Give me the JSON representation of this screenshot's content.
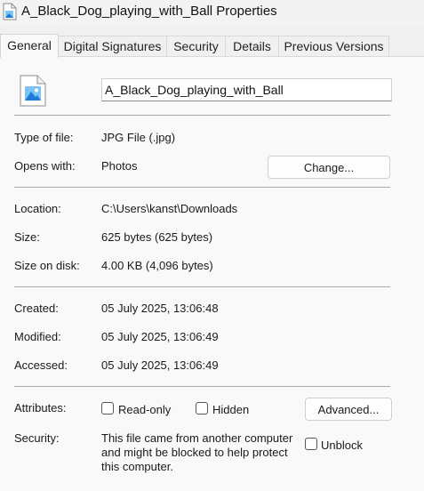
{
  "window": {
    "title": "A_Black_Dog_playing_with_Ball Properties",
    "icon": "image-file-icon"
  },
  "tabs": [
    {
      "label": "General",
      "active": true
    },
    {
      "label": "Digital Signatures",
      "active": false
    },
    {
      "label": "Security",
      "active": false
    },
    {
      "label": "Details",
      "active": false
    },
    {
      "label": "Previous Versions",
      "active": false
    }
  ],
  "file": {
    "name": "A_Black_Dog_playing_with_Ball",
    "icon": "image-file-icon"
  },
  "type_section": {
    "type_label": "Type of file:",
    "type_value": "JPG File (.jpg)",
    "opens_label": "Opens with:",
    "opens_value": "Photos",
    "change_button": "Change..."
  },
  "location_section": {
    "location_label": "Location:",
    "location_value": "C:\\Users\\kanst\\Downloads",
    "size_label": "Size:",
    "size_value": "625 bytes (625 bytes)",
    "size_on_disk_label": "Size on disk:",
    "size_on_disk_value": "4.00 KB (4,096 bytes)"
  },
  "dates_section": {
    "created_label": "Created:",
    "created_value": "05 July 2025, 13:06:48",
    "modified_label": "Modified:",
    "modified_value": "05 July 2025, 13:06:49",
    "accessed_label": "Accessed:",
    "accessed_value": "05 July 2025, 13:06:49"
  },
  "attributes_section": {
    "attributes_label": "Attributes:",
    "readonly_label": "Read-only",
    "readonly_checked": false,
    "hidden_label": "Hidden",
    "hidden_checked": false,
    "advanced_button": "Advanced...",
    "security_label": "Security:",
    "security_text": "This file came from another computer and might be blocked to help protect this computer.",
    "unblock_label": "Unblock",
    "unblock_checked": false
  },
  "colors": {
    "icon_blue": "#1f7bd6",
    "icon_light": "#7cc4f4"
  }
}
